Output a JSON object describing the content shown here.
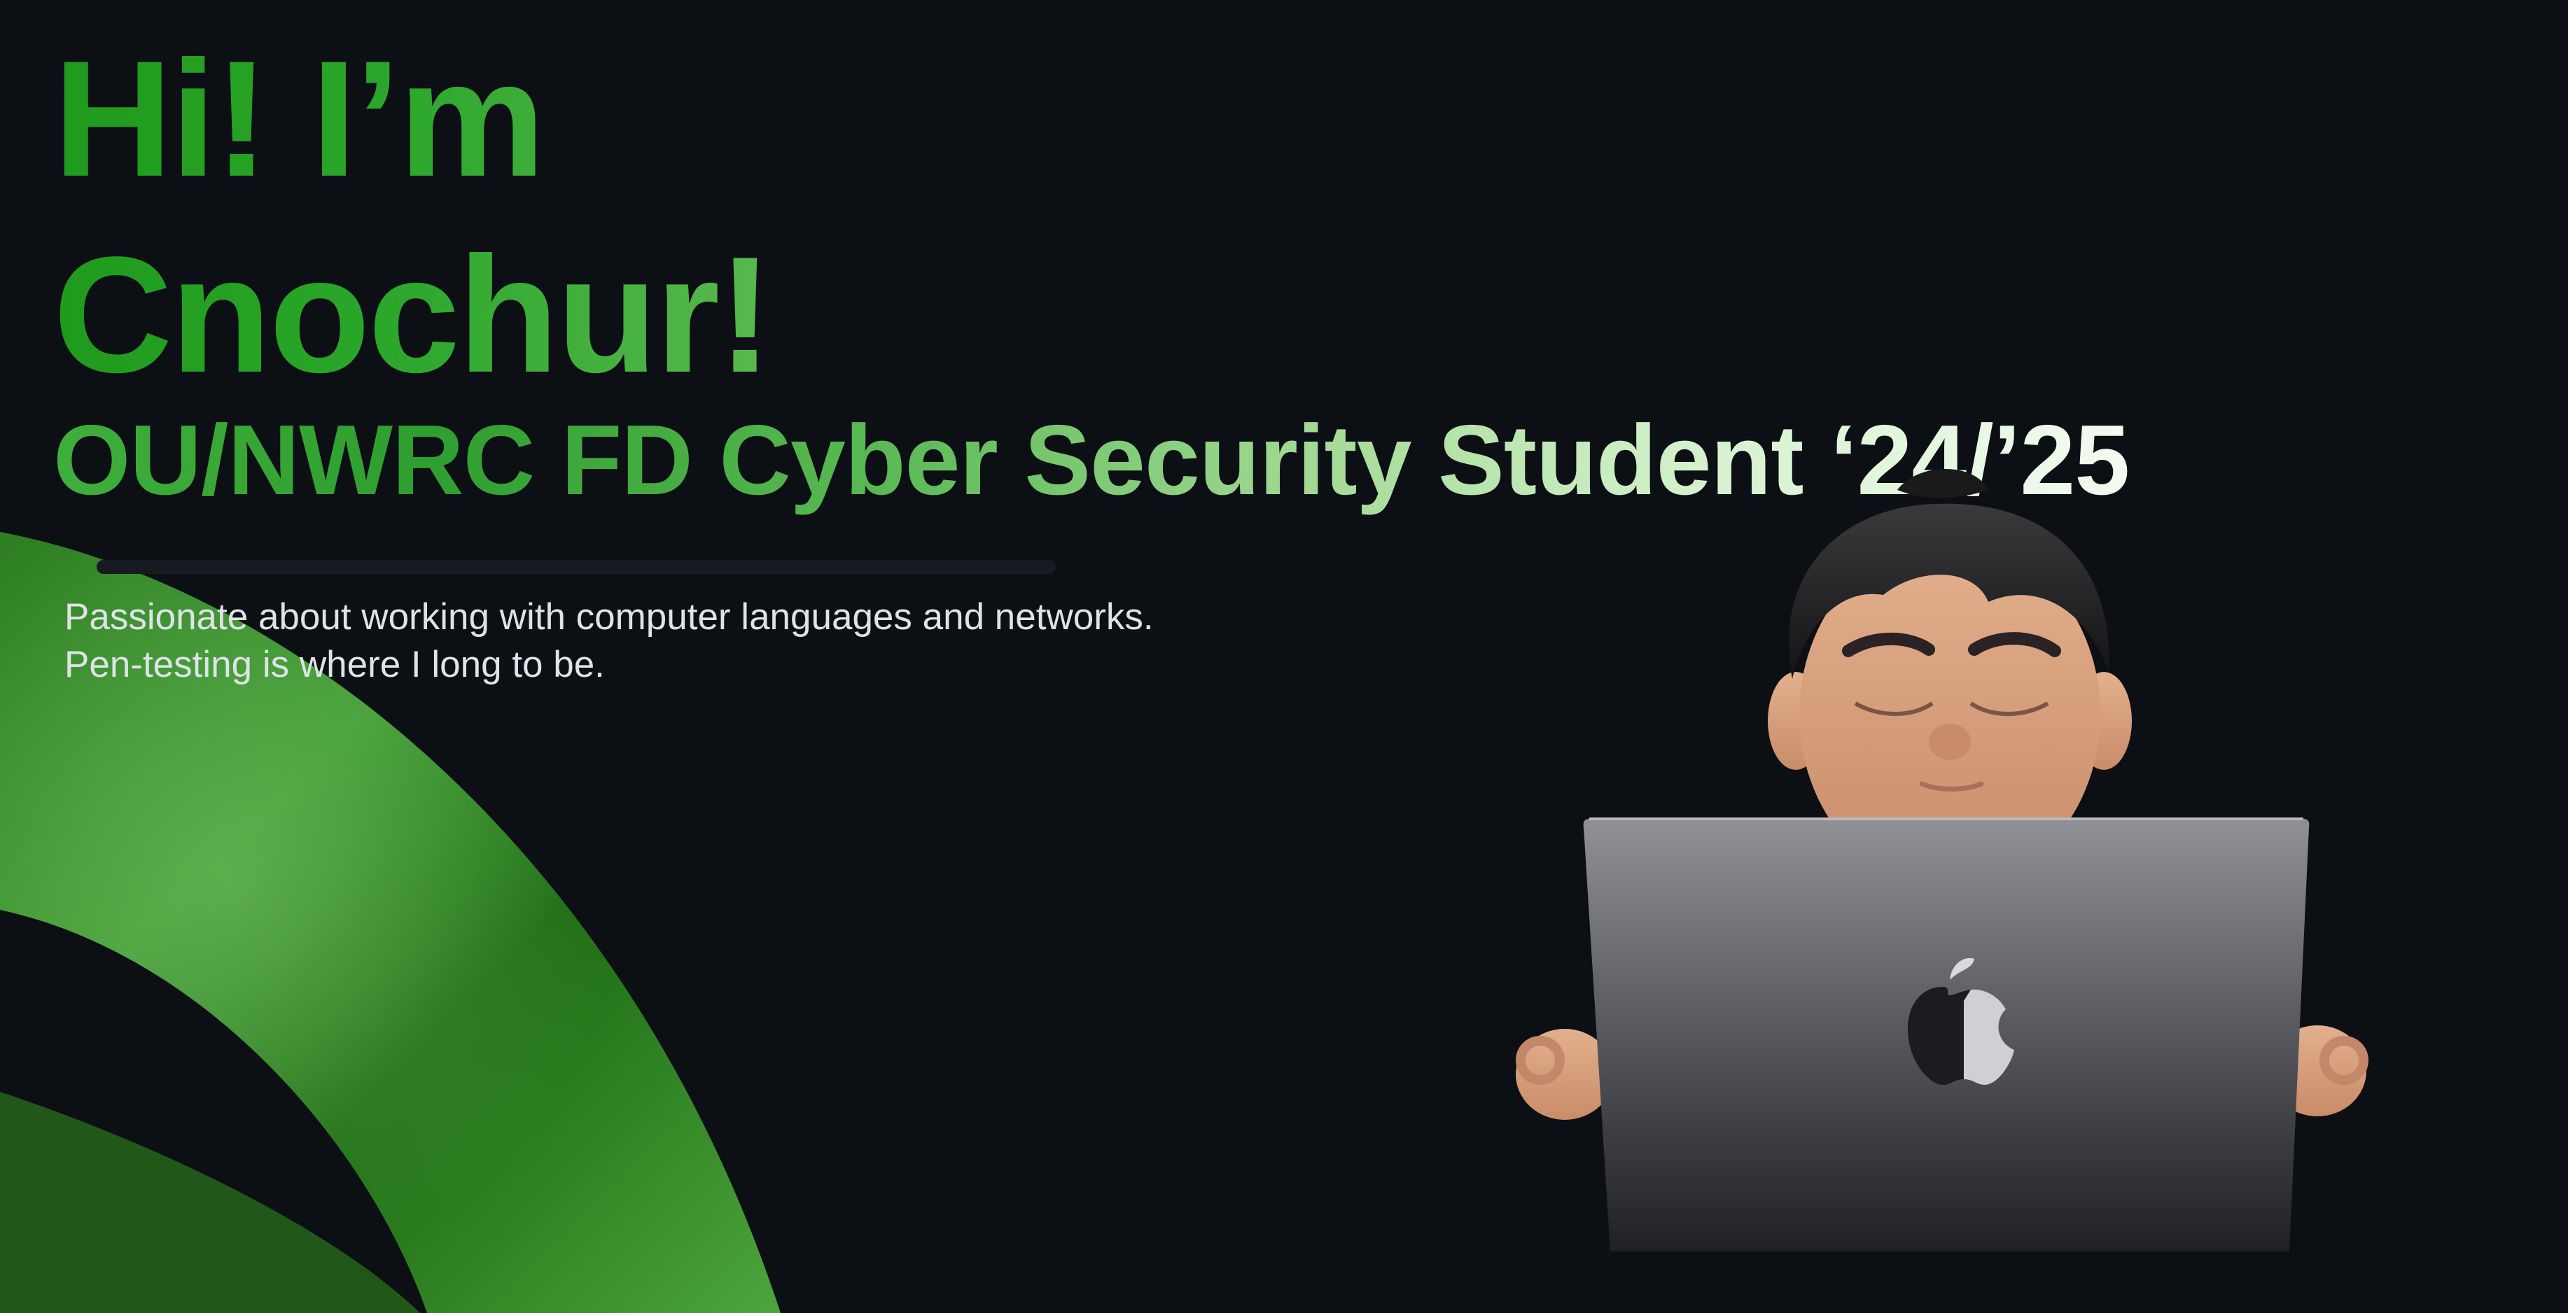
{
  "hero": {
    "line1": "Hi! I’m",
    "line2": "Cnochur!"
  },
  "subtitle": "OU/NWRC FD Cyber Security Student ‘24/’25",
  "bio": "Passionate about working with computer languages and networks. Pen-testing is where I long to be.",
  "icons": {
    "avatar": "memoji-avatar-with-laptop-icon",
    "laptop_logo": "apple-logo-icon",
    "decoration": "green-ribbon-shape"
  },
  "colors": {
    "background": "#0c0f14",
    "accent_green": "#2aa62a",
    "light_green": "#d6f2cf",
    "bio_text": "#dfe3e8"
  }
}
